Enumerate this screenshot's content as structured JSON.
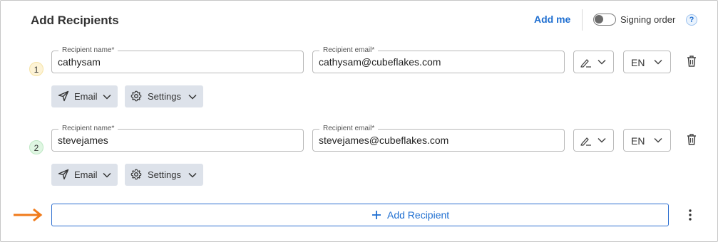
{
  "header": {
    "title": "Add Recipients",
    "add_me_label": "Add me",
    "signing_order_label": "Signing order",
    "signing_order_enabled": false,
    "help_symbol": "?"
  },
  "recipients": [
    {
      "number": "1",
      "name_label": "Recipient name*",
      "name_value": "cathysam",
      "email_label": "Recipient email*",
      "email_value": "cathysam@cubeflakes.com",
      "signer_role_icon": "sign-pen-icon",
      "language": "EN",
      "delivery_label": "Email",
      "settings_label": "Settings"
    },
    {
      "number": "2",
      "name_label": "Recipient name*",
      "name_value": "stevejames",
      "email_label": "Recipient email*",
      "email_value": "stevejames@cubeflakes.com",
      "signer_role_icon": "sign-pen-icon",
      "language": "EN",
      "delivery_label": "Email",
      "settings_label": "Settings"
    }
  ],
  "footer": {
    "add_recipient_label": "Add Recipient"
  },
  "colors": {
    "accent": "#1f6fd1",
    "pointer_arrow": "#f07a1a",
    "pill_bg": "#dde2ea"
  }
}
